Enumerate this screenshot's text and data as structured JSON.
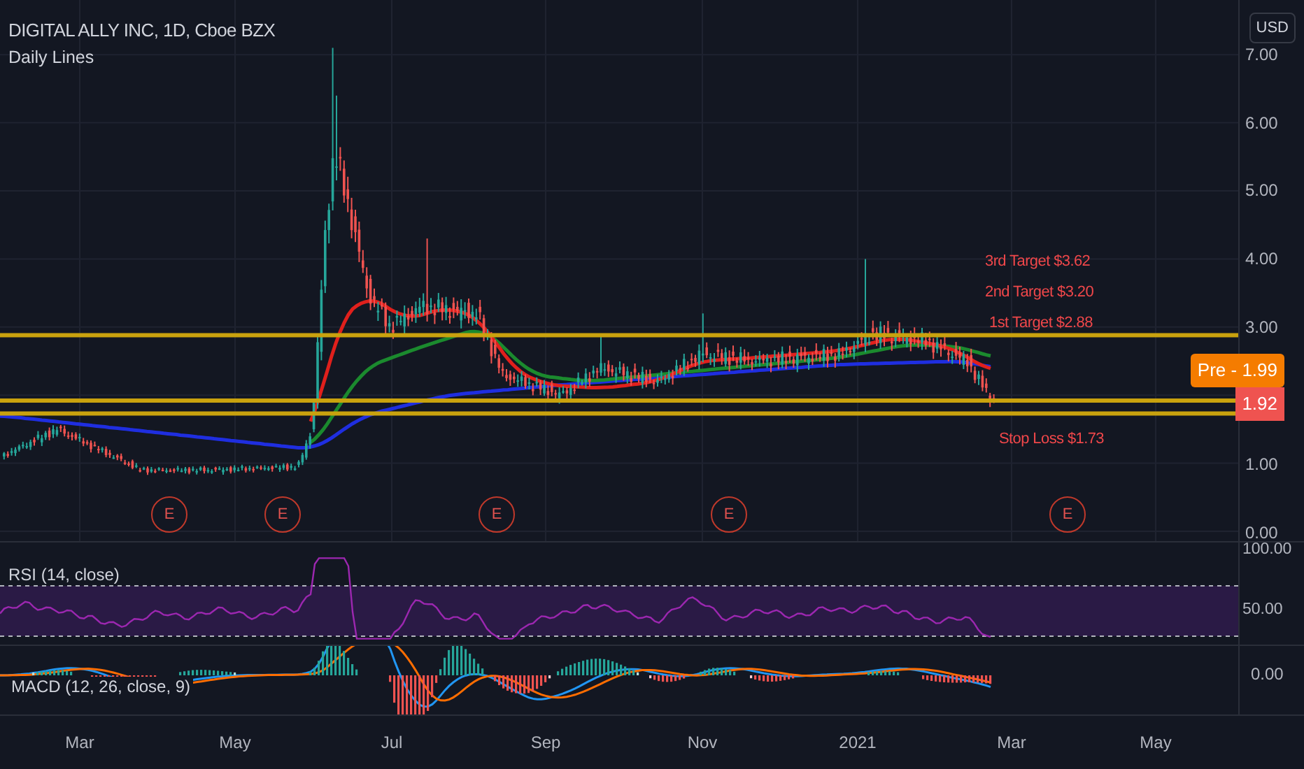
{
  "header": {
    "title": "DIGITAL ALLY INC, 1D, Cboe BZX",
    "indicator": "Daily Lines"
  },
  "currency_button": "USD",
  "price_axis": [
    "7.00",
    "6.00",
    "5.00",
    "4.00",
    "3.00",
    "1.00",
    "0.00"
  ],
  "annotations": [
    {
      "text": "3rd Target $3.62"
    },
    {
      "text": "2nd Target $3.20"
    },
    {
      "text": "1st Target $2.88"
    },
    {
      "text": "Stop Loss $1.73"
    }
  ],
  "badges": [
    {
      "kind": "premarket",
      "text": "Pre - 1.99"
    },
    {
      "kind": "last",
      "text": "1.92"
    }
  ],
  "earnings_markers": [
    "E",
    "E",
    "E",
    "E",
    "E"
  ],
  "rsi": {
    "label": "RSI (14, close)",
    "axis": [
      "100.00",
      "50.00"
    ]
  },
  "macd": {
    "label": "MACD (12, 26, close, 9)",
    "axis": [
      "0.00"
    ]
  },
  "time_axis": [
    "Mar",
    "May",
    "Jul",
    "Sep",
    "Nov",
    "2021",
    "Mar",
    "May"
  ]
}
